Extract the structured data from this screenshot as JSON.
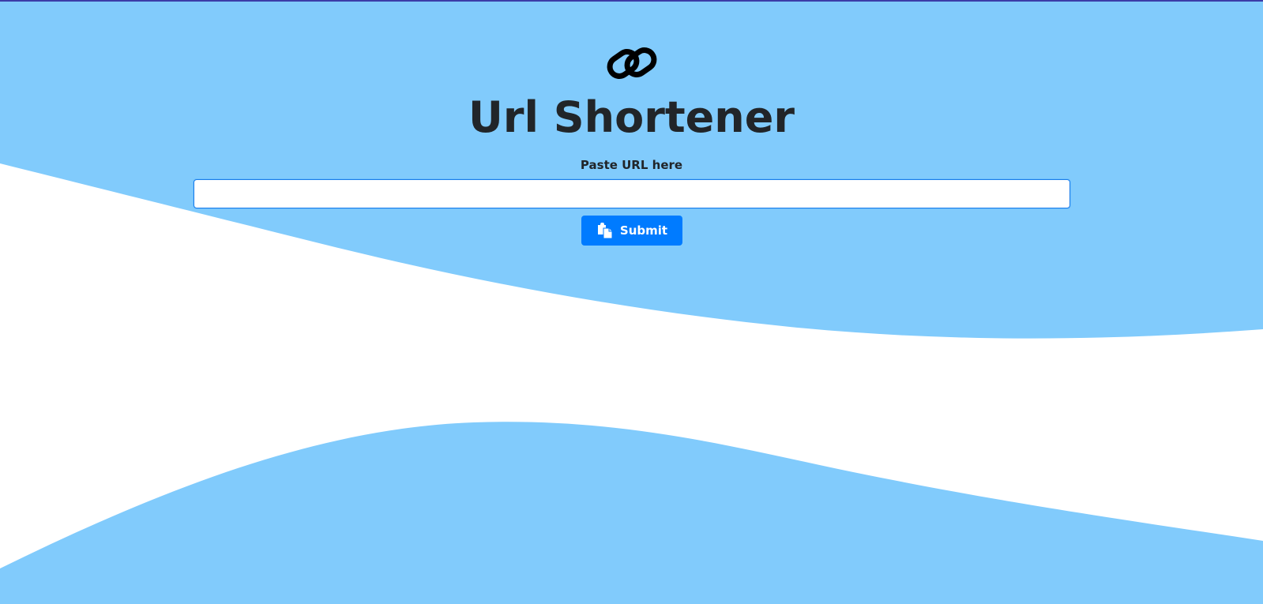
{
  "header": {
    "logo_icon": "link-icon",
    "title": "Url Shortener"
  },
  "form": {
    "label": "Paste URL here",
    "input_value": "",
    "input_placeholder": "",
    "submit_label": "Submit",
    "submit_icon": "paste-icon"
  },
  "colors": {
    "wave": "#81cbfc",
    "background": "#ffffff",
    "accent": "#007bff",
    "text": "#212529"
  }
}
